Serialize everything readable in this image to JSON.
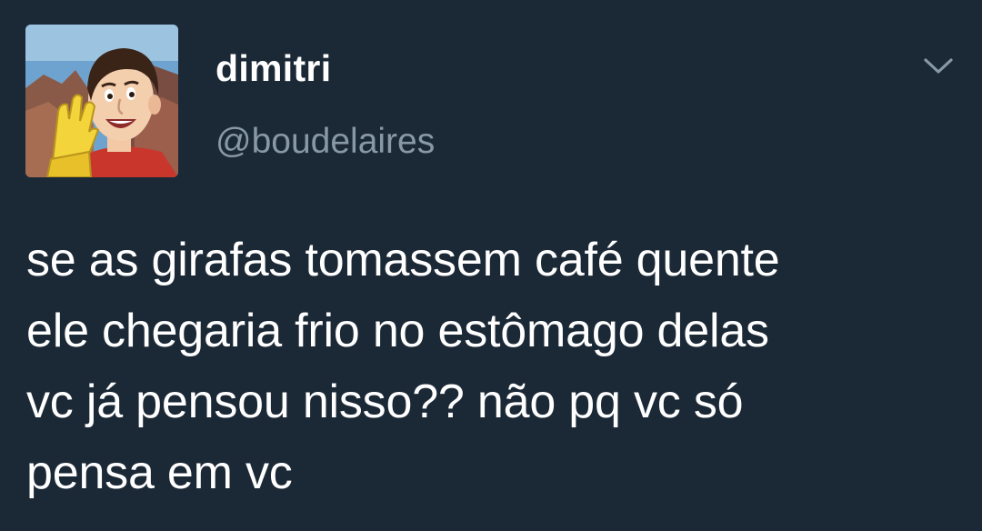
{
  "tweet": {
    "author": {
      "display_name": "dimitri",
      "handle": "@boudelaires",
      "avatar": "cartoon-man-waving-avatar"
    },
    "menu_icon": "chevron-down-icon",
    "text_lines": [
      "se as girafas tomassem café quente",
      "ele chegaria frio no estômago delas",
      "vc já pensou nisso?? não pq vc só",
      "pensa em vc"
    ]
  },
  "colors": {
    "background": "#1b2836",
    "primary_text": "#ffffff",
    "secondary_text": "#8899a6"
  }
}
